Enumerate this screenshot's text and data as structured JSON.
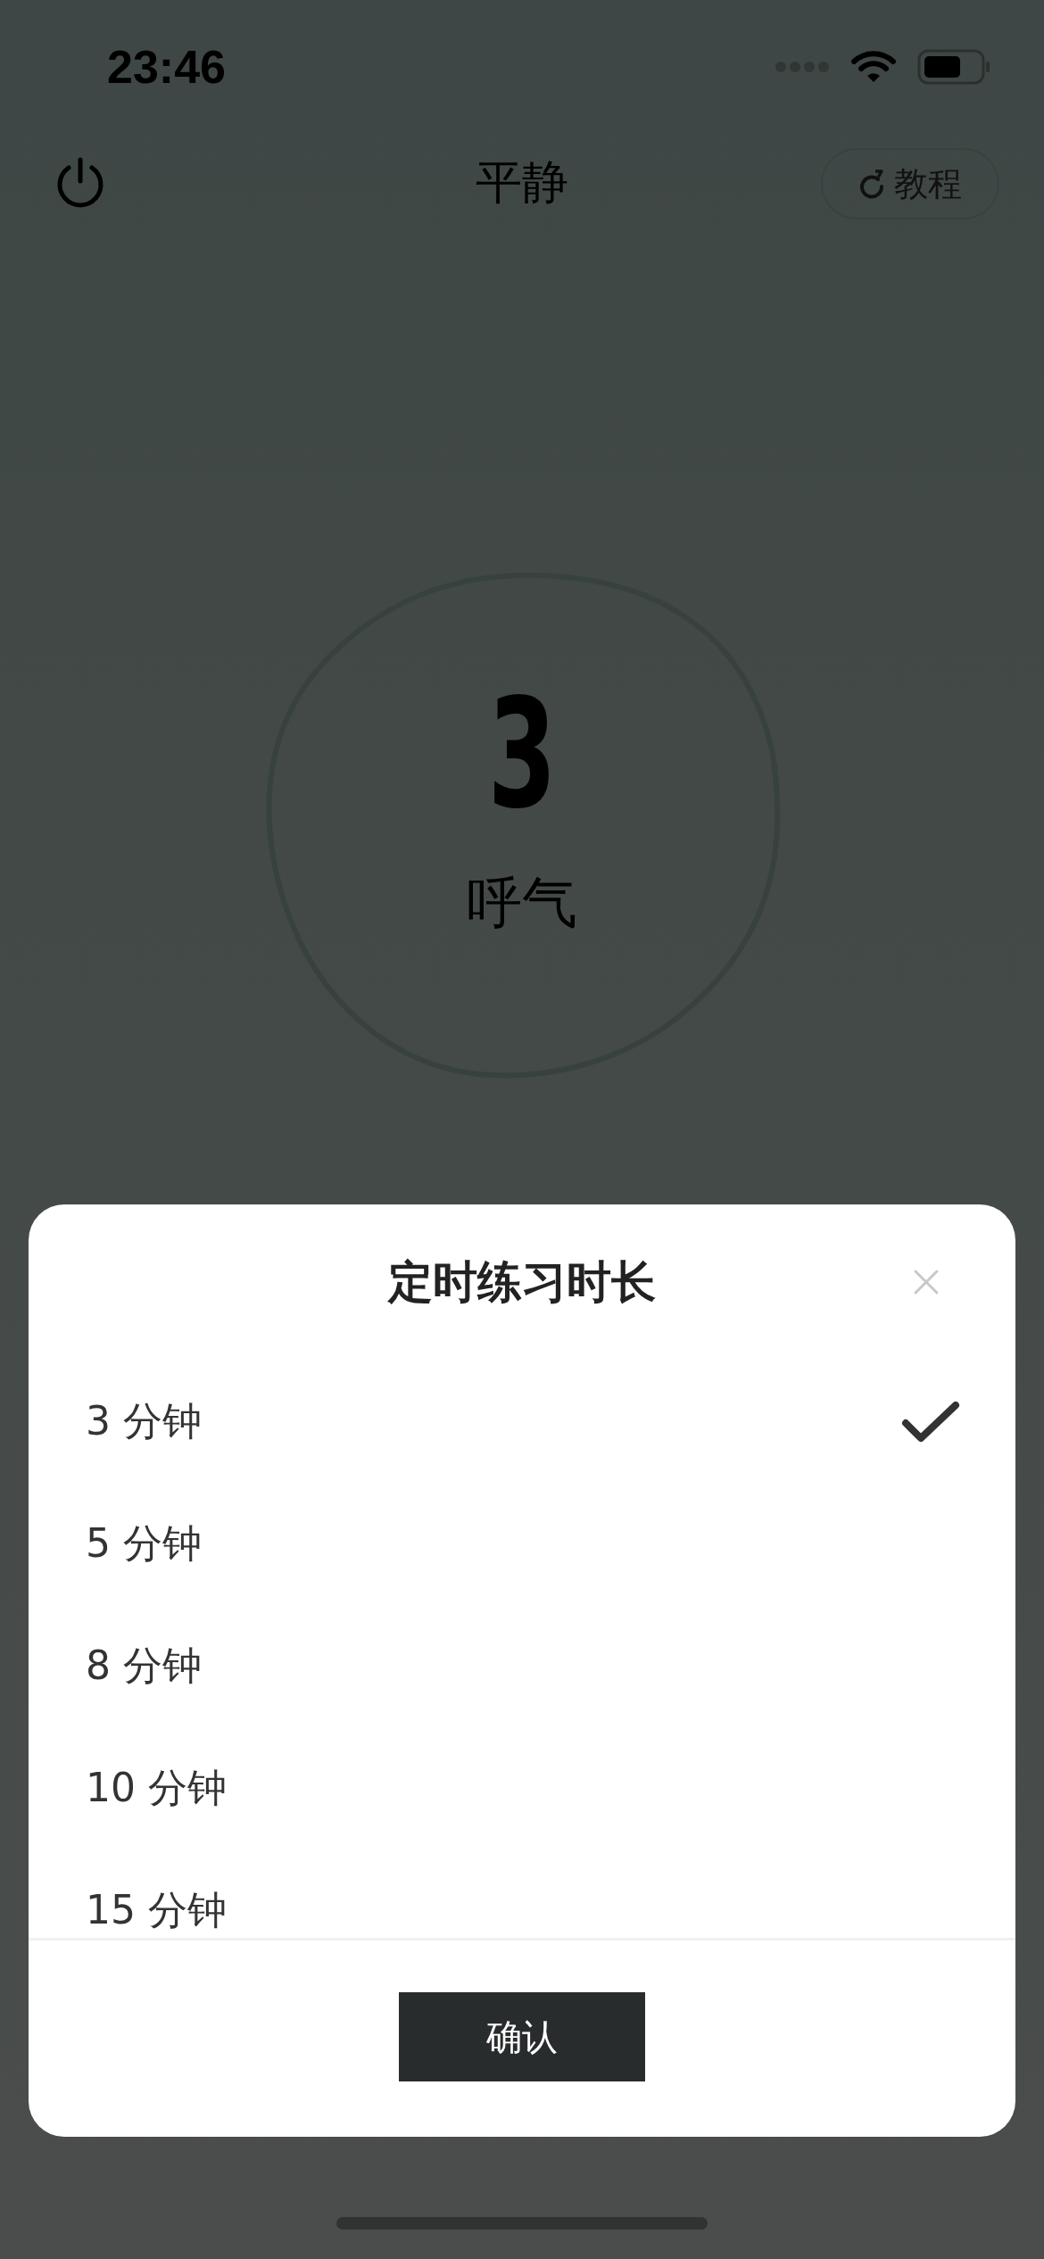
{
  "status_bar": {
    "time": "23:46"
  },
  "header": {
    "title": "平静",
    "tutorial_button": "教程"
  },
  "breath": {
    "count": "3",
    "phase": "呼气"
  },
  "sheet": {
    "title": "定时练习时长",
    "options": [
      {
        "label": "3 分钟",
        "selected": true
      },
      {
        "label": "5 分钟",
        "selected": false
      },
      {
        "label": "8 分钟",
        "selected": false
      },
      {
        "label": "10 分钟",
        "selected": false
      },
      {
        "label": "15 分钟",
        "selected": false
      }
    ],
    "confirm": "确认"
  }
}
